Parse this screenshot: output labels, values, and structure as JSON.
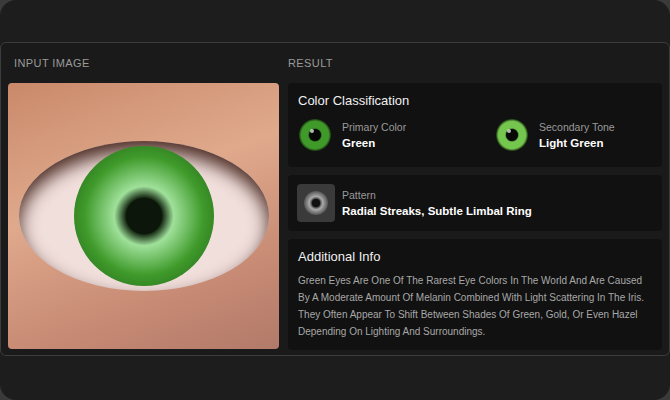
{
  "sections": {
    "input": "INPUT IMAGE",
    "result": "RESULT"
  },
  "classification": {
    "title": "Color Classification",
    "items": [
      {
        "label": "Primary Color",
        "value": "Green",
        "color": "#3f9a2a"
      },
      {
        "label": "Secondary Tone",
        "value": "Light Green",
        "color": "#74c64e"
      }
    ]
  },
  "pattern": {
    "label": "Pattern",
    "value": "Radial Streaks, Subtle Limbal Ring"
  },
  "info": {
    "title": "Additional Info",
    "text": "Green Eyes Are One Of The Rarest Eye Colors In The World And Are Caused By A Moderate Amount Of Melanin Combined With Light Scattering In The Iris. They Often Appear To Shift Between Shades Of Green, Gold, Or Even Hazel Depending On Lighting And Surroundings."
  }
}
